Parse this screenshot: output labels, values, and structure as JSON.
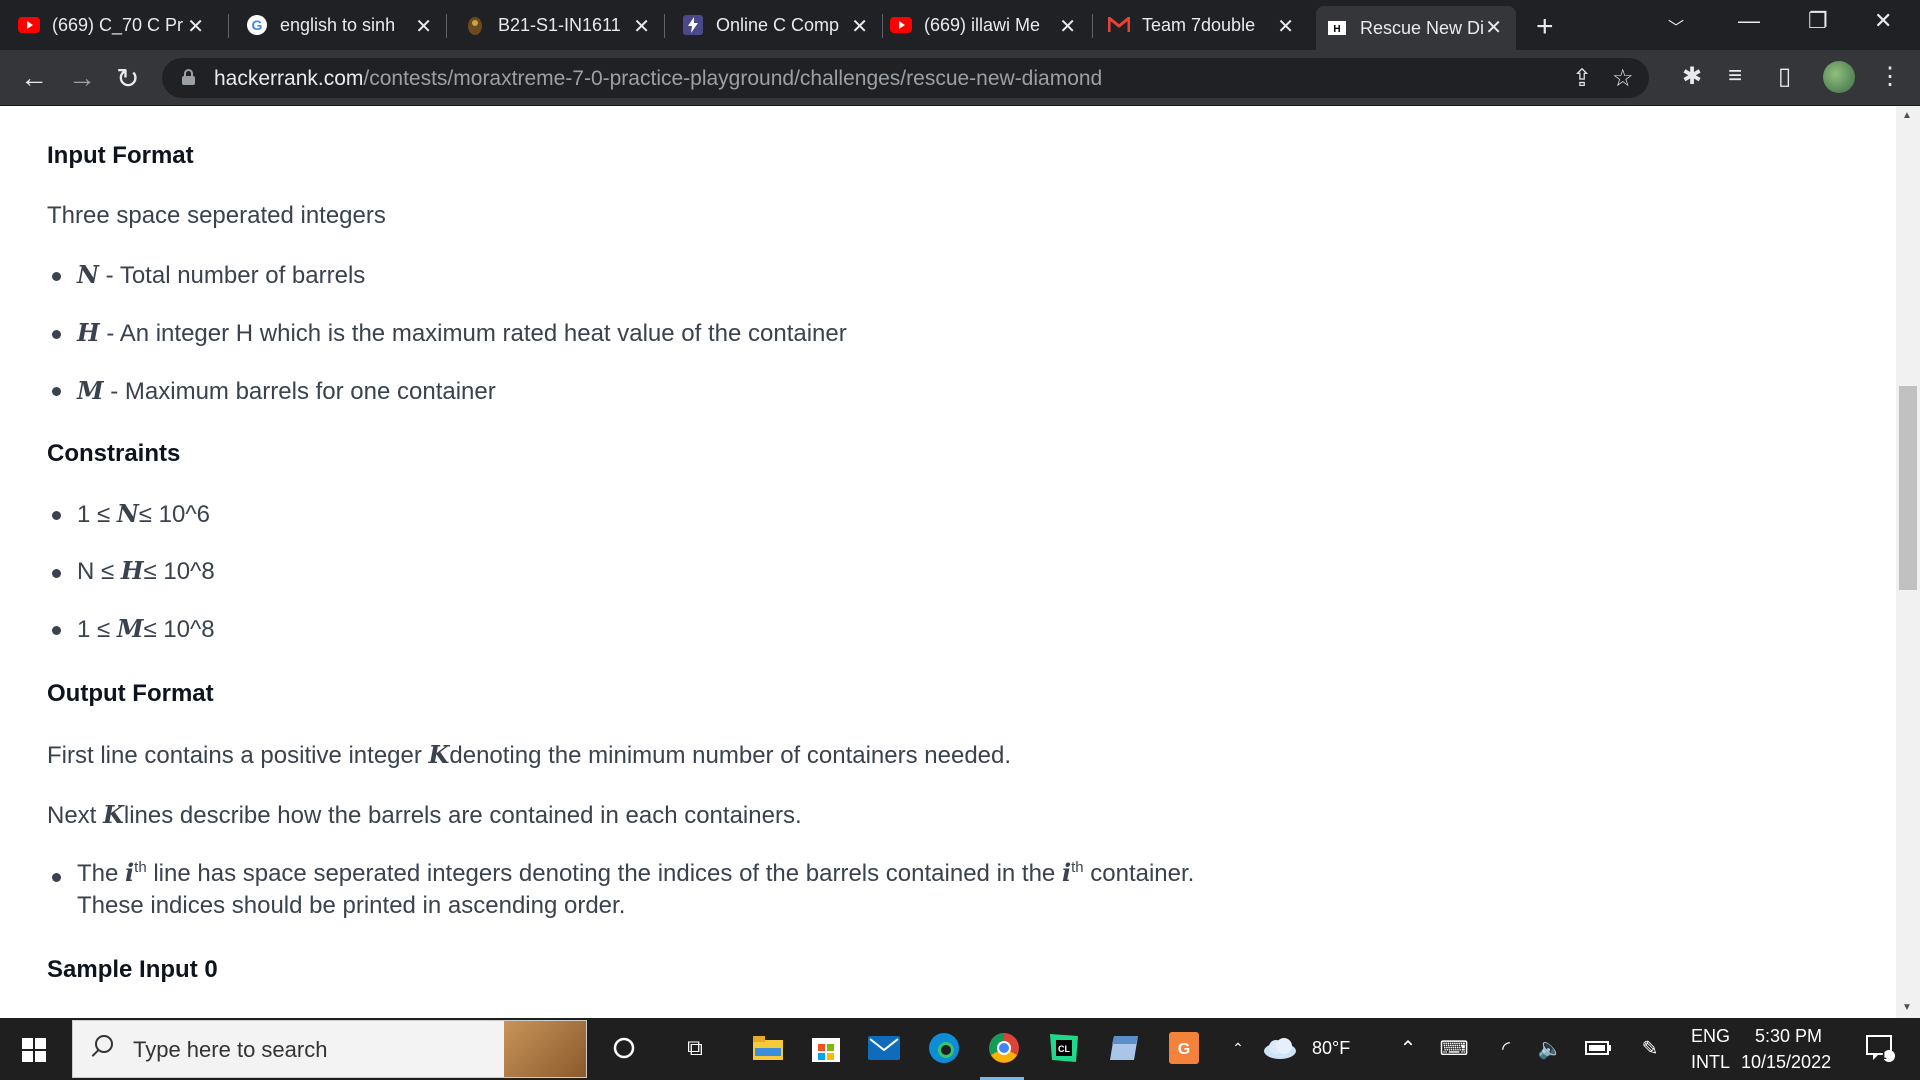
{
  "browser": {
    "tabs": [
      {
        "title": "(669) C_70 C Pr",
        "icon": "youtube-icon",
        "active": false
      },
      {
        "title": "english to sinh",
        "icon": "google-icon",
        "active": false
      },
      {
        "title": "B21-S1-IN1611",
        "icon": "moodle-icon",
        "active": false
      },
      {
        "title": "Online C Comp",
        "icon": "bolt-icon",
        "active": false
      },
      {
        "title": "(669) illawi Me",
        "icon": "youtube-icon",
        "active": false
      },
      {
        "title": "Team 7double",
        "icon": "gmail-icon",
        "active": false
      },
      {
        "title": "Rescue New Di",
        "icon": "hackerrank-icon",
        "active": true
      }
    ],
    "url_domain": "hackerrank.com",
    "url_path": "/contests/moraxtreme-7-0-practice-playground/challenges/rescue-new-diamond"
  },
  "content": {
    "input_format": {
      "heading": "Input Format",
      "intro": "Three space seperated integers",
      "items": [
        {
          "var": "N",
          "text": " - Total number of barrels"
        },
        {
          "var": "H",
          "text": " - An integer H which is the maximum rated heat value of the container"
        },
        {
          "var": "M",
          "text": " - Maximum barrels for one container"
        }
      ]
    },
    "constraints": {
      "heading": "Constraints",
      "items": [
        {
          "pre": "1 ≤ ",
          "var": "N",
          "post": "≤ 10^6"
        },
        {
          "pre": "N ≤ ",
          "var": "H",
          "post": "≤ 10^8"
        },
        {
          "pre": "1 ≤ ",
          "var": "M",
          "post": "≤ 10^8"
        }
      ]
    },
    "output_format": {
      "heading": "Output Format",
      "line1_pre": "First line contains a positive integer ",
      "line1_var": "K",
      "line1_post": "denoting the minimum number of containers needed.",
      "line2_pre": "Next ",
      "line2_var": "K",
      "line2_post": "lines describe how the barrels are contained in each containers.",
      "bullet_a": "The ",
      "bullet_var": "i",
      "bullet_sup": "th",
      "bullet_b": " line has space seperated integers denoting the indices of the barrels contained in the ",
      "bullet_c": " container.",
      "bullet_line2": "These indices should be printed in ascending order."
    },
    "sample_input_heading": "Sample Input 0"
  },
  "taskbar": {
    "search_placeholder": "Type here to search",
    "weather": "80°F",
    "lang_top": "ENG",
    "lang_bottom": "INTL",
    "time": "5:30 PM",
    "date": "10/15/2022",
    "notification_count": "1"
  }
}
